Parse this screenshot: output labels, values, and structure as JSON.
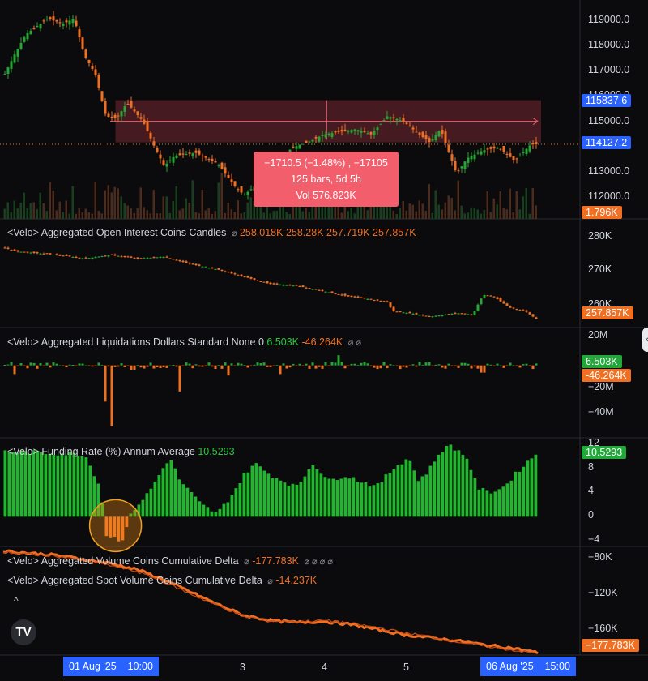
{
  "colors": {
    "up": "#26a634",
    "down": "#f07023",
    "blue": "#2962ff",
    "zone": "#5a2028",
    "measure": "#f25e6c"
  },
  "price": {
    "axis_labels": [
      "119000.0",
      "118000.0",
      "117000.0",
      "116000.0",
      "115000.0",
      "113000.0",
      "112000.0"
    ],
    "tags": {
      "high": "115837.6",
      "last": "114127.2",
      "volume": "1.796K"
    },
    "measure": {
      "line1": "−1710.5 (−1.48%) , −17105",
      "line2": "125 bars, 5d 5h",
      "line3": "Vol 576.823K"
    }
  },
  "oi": {
    "legend": {
      "title": "<Velo> Aggregated Open Interest Coins Candles",
      "icon": "⌀",
      "o": "258.018K",
      "h": "258.28K",
      "l": "257.719K",
      "c": "257.857K"
    },
    "axis_labels": [
      "280K",
      "270K",
      "260K"
    ],
    "tag": "257.857K"
  },
  "liq": {
    "legend": {
      "title": "<Velo> Aggregated Liquidations Dollars Standard None 0",
      "v1": "6.503K",
      "v2": "-46.264K",
      "icons": "⌀ ⌀"
    },
    "axis_labels": [
      "20M",
      "−20M",
      "−40M"
    ],
    "tag_up": "6.503K",
    "tag_down": "-46.264K"
  },
  "funding": {
    "legend": {
      "title": "<Velo> Funding Rate (%) Annum Average",
      "value": "10.5293"
    },
    "axis_labels": [
      "12",
      "8",
      "4",
      "0",
      "−4"
    ],
    "tag": "10.5293"
  },
  "cvd": {
    "legend1": {
      "title": "<Velo> Aggregated Volume Coins Cumulative Delta",
      "icon": "⌀",
      "value": "-177.783K",
      "icons": "⌀ ⌀ ⌀ ⌀"
    },
    "legend2": {
      "title": "<Velo> Aggregated Spot Volume Coins Cumulative Delta",
      "icon": "⌀",
      "value": "-14.237K"
    },
    "axis_labels": [
      "−80K",
      "−120K",
      "−160K"
    ],
    "tag": "−177.783K"
  },
  "xaxis": {
    "start_date": "01 Aug '25",
    "start_time": "10:00",
    "ticks": [
      "3",
      "4",
      "5"
    ],
    "end_date": "06 Aug '25",
    "end_time": "15:00"
  },
  "logo": "TV",
  "chart_data": [
    {
      "type": "candlestick",
      "pane": "price",
      "ylim": [
        111300,
        119600
      ],
      "close_path": [
        [
          0,
          116800
        ],
        [
          0.02,
          117600
        ],
        [
          0.04,
          118300
        ],
        [
          0.08,
          118900
        ],
        [
          0.11,
          118700
        ],
        [
          0.13,
          118900
        ],
        [
          0.15,
          117500
        ],
        [
          0.17,
          116800
        ],
        [
          0.19,
          115200
        ],
        [
          0.21,
          115100
        ],
        [
          0.23,
          115700
        ],
        [
          0.26,
          115000
        ],
        [
          0.28,
          114100
        ],
        [
          0.3,
          113300
        ],
        [
          0.32,
          113700
        ],
        [
          0.36,
          113800
        ],
        [
          0.4,
          113400
        ],
        [
          0.43,
          112600
        ],
        [
          0.45,
          112200
        ],
        [
          0.48,
          112700
        ],
        [
          0.51,
          113300
        ],
        [
          0.54,
          114000
        ],
        [
          0.57,
          114200
        ],
        [
          0.6,
          114500
        ],
        [
          0.63,
          114600
        ],
        [
          0.66,
          114700
        ],
        [
          0.69,
          114500
        ],
        [
          0.72,
          115200
        ],
        [
          0.75,
          115000
        ],
        [
          0.78,
          114500
        ],
        [
          0.8,
          114200
        ],
        [
          0.82,
          114700
        ],
        [
          0.84,
          113600
        ],
        [
          0.85,
          113000
        ],
        [
          0.87,
          113600
        ],
        [
          0.9,
          113900
        ],
        [
          0.93,
          114000
        ],
        [
          0.96,
          113500
        ],
        [
          0.99,
          114127
        ]
      ],
      "zone": {
        "y1": 114200,
        "y2": 115800,
        "x_start": 0.21
      },
      "measure_line": 115000
    },
    {
      "type": "candlestick",
      "pane": "open_interest",
      "ylim": [
        255500,
        285000
      ],
      "close_path": [
        [
          0,
          277500
        ],
        [
          0.02,
          276500
        ],
        [
          0.1,
          275500
        ],
        [
          0.15,
          274500
        ],
        [
          0.2,
          275500
        ],
        [
          0.25,
          274500
        ],
        [
          0.3,
          275000
        ],
        [
          0.35,
          273000
        ],
        [
          0.4,
          271500
        ],
        [
          0.45,
          269500
        ],
        [
          0.5,
          267500
        ],
        [
          0.55,
          267000
        ],
        [
          0.6,
          265500
        ],
        [
          0.65,
          264000
        ],
        [
          0.7,
          263000
        ],
        [
          0.72,
          262500
        ],
        [
          0.73,
          260000
        ],
        [
          0.76,
          259500
        ],
        [
          0.8,
          258500
        ],
        [
          0.85,
          259500
        ],
        [
          0.88,
          259000
        ],
        [
          0.9,
          264500
        ],
        [
          0.92,
          264000
        ],
        [
          0.95,
          261000
        ],
        [
          0.98,
          260000
        ],
        [
          1.0,
          257857
        ]
      ]
    },
    {
      "type": "bar",
      "pane": "liquidations",
      "ylim": [
        -50000000,
        25000000
      ],
      "spikes": [
        [
          0.02,
          -6000000
        ],
        [
          0.19,
          -25000000
        ],
        [
          0.2,
          -42000000
        ],
        [
          0.24,
          -3000000
        ],
        [
          0.33,
          -18000000
        ],
        [
          0.42,
          -7000000
        ],
        [
          0.52,
          -6000000
        ],
        [
          0.63,
          7000000
        ],
        [
          0.9,
          -5000000
        ]
      ]
    },
    {
      "type": "bar",
      "pane": "funding_rate",
      "ylim": [
        -5,
        13
      ],
      "path": [
        [
          0,
          11
        ],
        [
          0.15,
          10.5
        ],
        [
          0.18,
          5
        ],
        [
          0.19,
          -3
        ],
        [
          0.22,
          -4
        ],
        [
          0.24,
          1
        ],
        [
          0.27,
          4
        ],
        [
          0.29,
          7
        ],
        [
          0.31,
          10
        ],
        [
          0.33,
          6
        ],
        [
          0.37,
          2
        ],
        [
          0.4,
          0.5
        ],
        [
          0.43,
          4
        ],
        [
          0.45,
          7
        ],
        [
          0.47,
          9
        ],
        [
          0.5,
          7
        ],
        [
          0.55,
          5
        ],
        [
          0.58,
          9
        ],
        [
          0.61,
          6
        ],
        [
          0.64,
          7
        ],
        [
          0.67,
          6
        ],
        [
          0.7,
          5
        ],
        [
          0.73,
          8
        ],
        [
          0.76,
          10
        ],
        [
          0.78,
          6
        ],
        [
          0.8,
          8
        ],
        [
          0.82,
          11
        ],
        [
          0.84,
          12
        ],
        [
          0.87,
          10
        ],
        [
          0.89,
          5
        ],
        [
          0.91,
          4
        ],
        [
          0.94,
          5
        ],
        [
          0.97,
          8
        ],
        [
          1.0,
          10.5293
        ]
      ]
    },
    {
      "type": "line",
      "pane": "cumulative_delta",
      "ylim": [
        -180000,
        -75000
      ],
      "series": [
        {
          "values": [
            [
              0,
              -78000
            ],
            [
              0.1,
              -82000
            ],
            [
              0.2,
              -90000
            ],
            [
              0.25,
              -96000
            ],
            [
              0.3,
              -106000
            ],
            [
              0.35,
              -118000
            ],
            [
              0.4,
              -130000
            ],
            [
              0.45,
              -141000
            ],
            [
              0.5,
              -146000
            ],
            [
              0.55,
              -148000
            ],
            [
              0.6,
              -147000
            ],
            [
              0.65,
              -150000
            ],
            [
              0.7,
              -155000
            ],
            [
              0.75,
              -160000
            ],
            [
              0.8,
              -163000
            ],
            [
              0.85,
              -166000
            ],
            [
              0.9,
              -170000
            ],
            [
              0.95,
              -173000
            ],
            [
              1.0,
              -177783
            ]
          ]
        },
        {
          "values": [
            [
              0,
              -79000
            ],
            [
              0.1,
              -83000
            ],
            [
              0.2,
              -92000
            ],
            [
              0.25,
              -98000
            ],
            [
              0.3,
              -108000
            ],
            [
              0.35,
              -120000
            ],
            [
              0.4,
              -131000
            ],
            [
              0.45,
              -142000
            ],
            [
              0.5,
              -146500
            ],
            [
              0.55,
              -147000
            ],
            [
              0.6,
              -146000
            ],
            [
              0.65,
              -149000
            ],
            [
              0.7,
              -153000
            ],
            [
              0.75,
              -158000
            ],
            [
              0.8,
              -162000
            ],
            [
              0.85,
              -167000
            ],
            [
              0.9,
              -171000
            ],
            [
              0.95,
              -175000
            ],
            [
              1.0,
              -178500
            ]
          ]
        }
      ]
    }
  ]
}
